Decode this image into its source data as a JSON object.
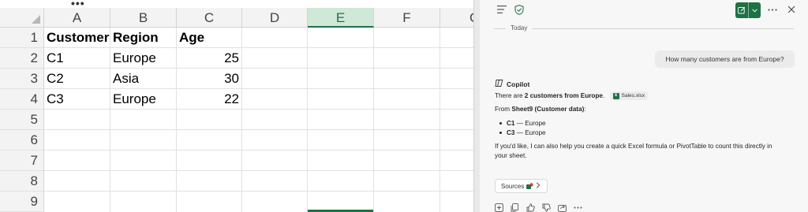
{
  "sheet": {
    "toolbar_dots": "•••",
    "columns": [
      "A",
      "B",
      "C",
      "D",
      "E",
      "F",
      "G"
    ],
    "selected_column": "E",
    "rows": [
      "1",
      "2",
      "3",
      "4",
      "5",
      "6",
      "7",
      "8",
      "9"
    ],
    "cells": {
      "header": [
        "Customer",
        "Region",
        "Age"
      ],
      "data": [
        [
          "C1",
          "Europe",
          "25"
        ],
        [
          "C2",
          "Asia",
          "30"
        ],
        [
          "C3",
          "Europe",
          "22"
        ]
      ]
    },
    "colors": {
      "accent": "#1e7145",
      "header_bg": "#f3f3f3",
      "grid": "#e1e1e1"
    }
  },
  "copilot": {
    "today_label": "Today",
    "user_message": "How many customers are from Europe?",
    "assistant_name": "Copilot",
    "answer_prefix": "There are ",
    "answer_bold": "2 customers from Europe",
    "answer_suffix": ".",
    "file_chip": "Sales.xlsx",
    "from_prefix": "From ",
    "from_bold": "Sheet9 (Customer data)",
    "from_suffix": ":",
    "bullets": [
      {
        "id": "C1",
        "rest": " — Europe"
      },
      {
        "id": "C3",
        "rest": " — Europe"
      }
    ],
    "followup_line1": "If you'd like, I can also help you create a quick Excel formula or PivotTable to count this directly in",
    "followup_line2": "your sheet.",
    "sources_label": "Sources",
    "icons": {
      "menu": "hamburger-icon",
      "shield": "shield-check-icon",
      "new_chat": "edit-icon",
      "more": "more-icon",
      "close": "close-icon"
    }
  }
}
